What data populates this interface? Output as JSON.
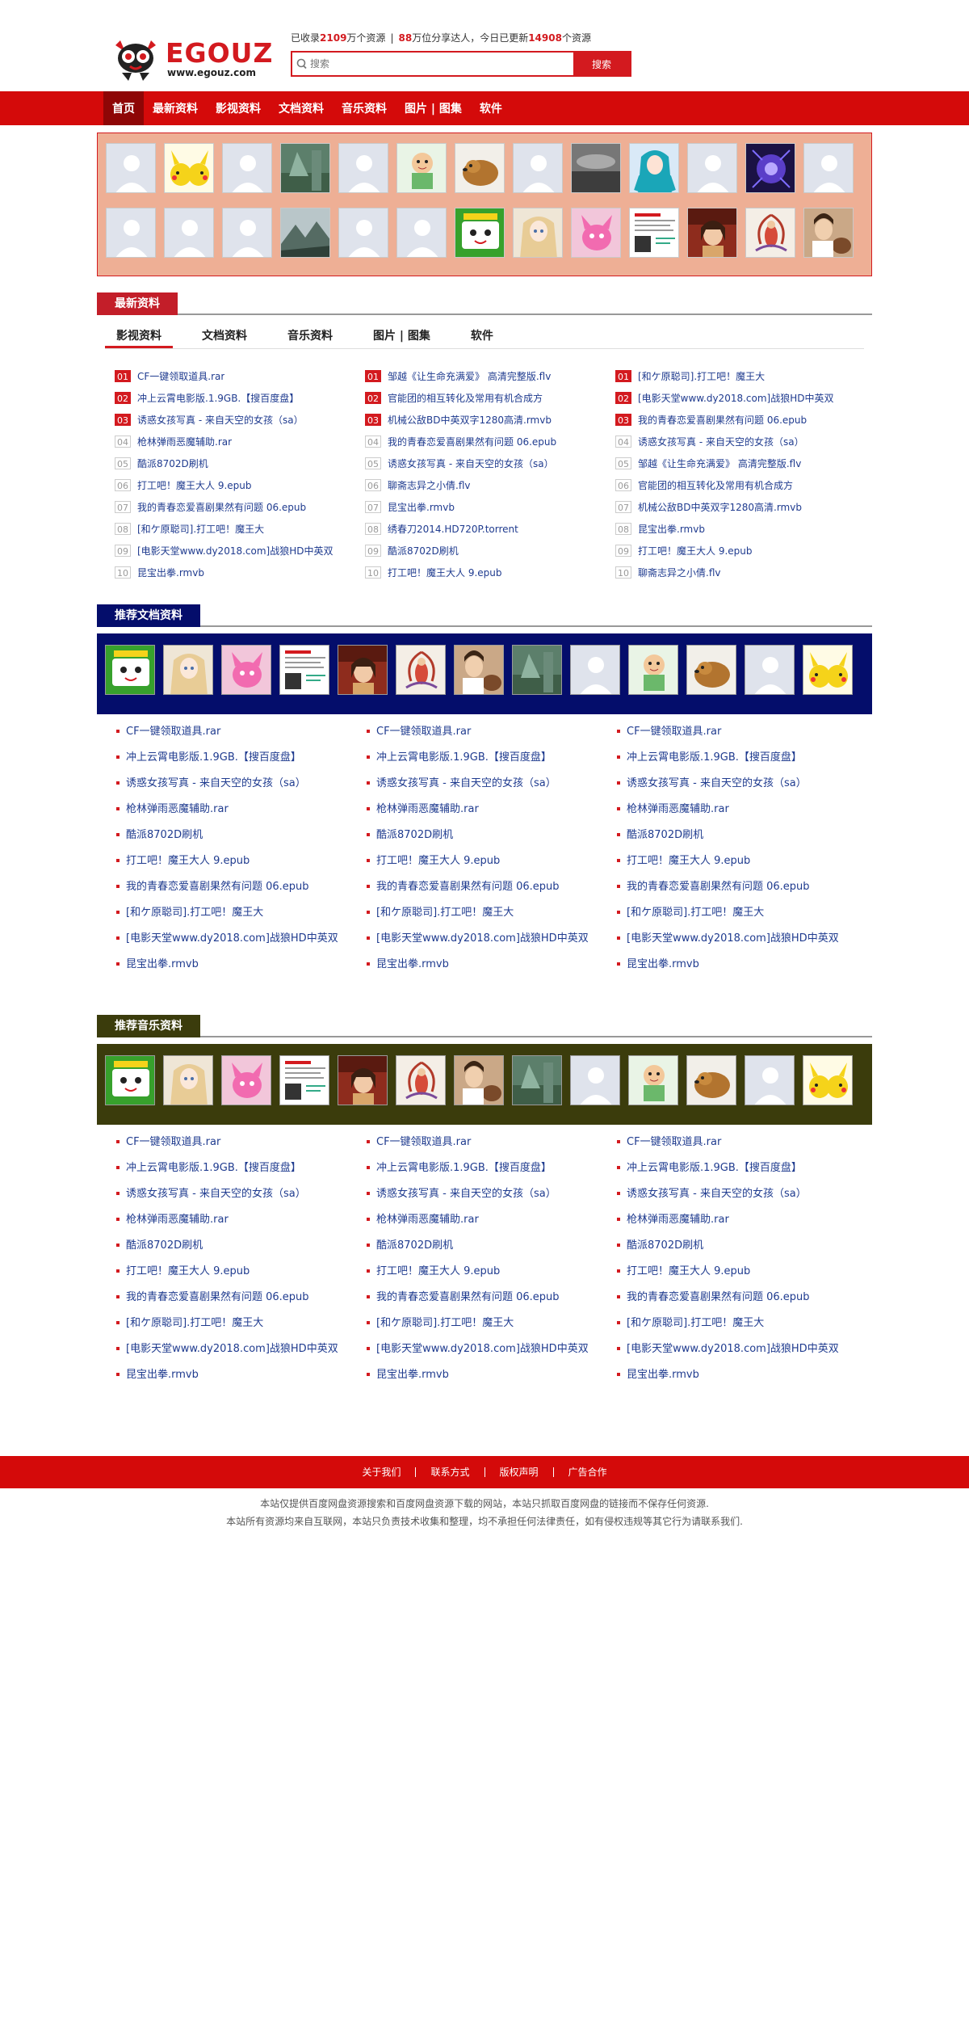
{
  "brand": {
    "name": "EGOUZ",
    "url": "www.egouz.com"
  },
  "stats": {
    "p1": "已收录",
    "n1": "2109",
    "p2": "万个资源",
    "sep": "|",
    "n2": "88",
    "p3": "万位分享达人，今日已更新",
    "n3": "14908",
    "p4": "个资源"
  },
  "search": {
    "placeholder": "搜索",
    "button": "搜索"
  },
  "nav": [
    "首页",
    "最新资料",
    "影视资料",
    "文档资料",
    "音乐资料",
    "图片 | 图集",
    "软件"
  ],
  "latest": {
    "title": "最新资料",
    "tabs": [
      "影视资料",
      "文档资料",
      "音乐资料",
      "图片 | 图集",
      "软件"
    ],
    "columns": [
      [
        "CF一键领取道具.rar",
        "冲上云霄电影版.1.9GB.【搜百度盘】",
        "诱惑女孩写真 - 来自天空的女孩（sa）",
        "枪林弹雨恶魔辅助.rar",
        "酷派8702D刷机",
        "打工吧！魔王大人 9.epub",
        "我的青春恋爱喜剧果然有问题 06.epub",
        "[和ケ原聪司].打工吧！魔王大",
        "[电影天堂www.dy2018.com]战狼HD中英双",
        "昆宝出拳.rmvb"
      ],
      [
        "邹越《让生命充满爱》 高清完整版.flv",
        "官能团的相互转化及常用有机合成方",
        "机械公敌BD中英双字1280高清.rmvb",
        "我的青春恋爱喜剧果然有问题 06.epub",
        "诱惑女孩写真 - 来自天空的女孩（sa）",
        "聊斋志异之小倩.flv",
        "昆宝出拳.rmvb",
        "绣春刀2014.HD720P.torrent",
        "酷派8702D刷机",
        "打工吧！魔王大人 9.epub"
      ],
      [
        "[和ケ原聪司].打工吧！魔王大",
        "[电影天堂www.dy2018.com]战狼HD中英双",
        "我的青春恋爱喜剧果然有问题 06.epub",
        "诱惑女孩写真 - 来自天空的女孩（sa）",
        "邹越《让生命充满爱》 高清完整版.flv",
        "官能团的相互转化及常用有机合成方",
        "机械公敌BD中英双字1280高清.rmvb",
        "昆宝出拳.rmvb",
        "打工吧！魔王大人 9.epub",
        "聊斋志异之小倩.flv"
      ]
    ]
  },
  "docs": {
    "title": "推荐文档资料",
    "items": [
      "CF一键领取道具.rar",
      "冲上云霄电影版.1.9GB.【搜百度盘】",
      "诱惑女孩写真 - 来自天空的女孩（sa）",
      "枪林弹雨恶魔辅助.rar",
      "酷派8702D刷机",
      "打工吧！魔王大人 9.epub",
      "我的青春恋爱喜剧果然有问题 06.epub",
      "[和ケ原聪司].打工吧！魔王大",
      "[电影天堂www.dy2018.com]战狼HD中英双",
      "昆宝出拳.rmvb"
    ]
  },
  "music": {
    "title": "推荐音乐资料",
    "items": [
      "CF一键领取道具.rar",
      "冲上云霄电影版.1.9GB.【搜百度盘】",
      "诱惑女孩写真 - 来自天空的女孩（sa）",
      "枪林弹雨恶魔辅助.rar",
      "酷派8702D刷机",
      "打工吧！魔王大人 9.epub",
      "我的青春恋爱喜剧果然有问题 06.epub",
      "[和ケ原聪司].打工吧！魔王大",
      "[电影天堂www.dy2018.com]战狼HD中英双",
      "昆宝出拳.rmvb"
    ]
  },
  "avatars": {
    "row1": [
      "default",
      "pikachu",
      "default",
      "tree",
      "default",
      "cartoon-boy",
      "puppy",
      "default",
      "cloud",
      "anime-girl",
      "default",
      "music-icon",
      "default"
    ],
    "row2": [
      "default",
      "default",
      "default",
      "mountain",
      "default",
      "default",
      "green-logo",
      "anime-blonde",
      "pink-creature",
      "document",
      "girl-red",
      "fantasy",
      "woman-dog"
    ]
  },
  "strip": [
    "green-logo",
    "anime-blonde",
    "pink-creature",
    "document",
    "girl-red",
    "fantasy",
    "woman-dog",
    "tree",
    "default",
    "cartoon-boy",
    "puppy",
    "default",
    "pikachu"
  ],
  "footer": {
    "links": [
      "关于我们",
      "联系方式",
      "版权声明",
      "广告合作"
    ],
    "line1": "本站仅提供百度网盘资源搜索和百度网盘资源下载的网站，本站只抓取百度网盘的链接而不保存任何资源.",
    "line2": "本站所有资源均来自互联网，本站只负责技术收集和整理，均不承担任何法律责任，如有侵权违规等其它行为请联系我们."
  },
  "colors": {
    "brand_red": "#d40a0a",
    "navy": "#040d6b",
    "olive": "#3b3c0c",
    "salmon": "#eeaf95",
    "link": "#1f3b8f"
  }
}
